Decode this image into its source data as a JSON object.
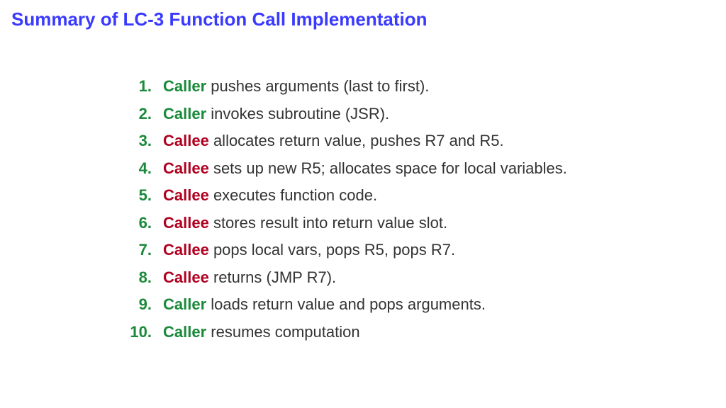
{
  "title": "Summary of LC-3 Function Call Implementation",
  "items": [
    {
      "n": "1.",
      "role": "Caller",
      "role_class": "role-caller",
      "text": " pushes arguments (last to first)."
    },
    {
      "n": "2.",
      "role": "Caller",
      "role_class": "role-caller",
      "text": " invokes subroutine (JSR)."
    },
    {
      "n": "3.",
      "role": "Callee",
      "role_class": "role-callee",
      "text": " allocates return value, pushes R7 and R5."
    },
    {
      "n": "4.",
      "role": "Callee",
      "role_class": "role-callee",
      "text": " sets up new R5; allocates space for local variables."
    },
    {
      "n": "5.",
      "role": "Callee",
      "role_class": "role-callee",
      "text": " executes function code."
    },
    {
      "n": "6.",
      "role": "Callee",
      "role_class": "role-callee",
      "text": " stores result into return value slot."
    },
    {
      "n": "7.",
      "role": "Callee",
      "role_class": "role-callee",
      "text": " pops local vars, pops R5, pops R7."
    },
    {
      "n": "8.",
      "role": "Callee",
      "role_class": "role-callee",
      "text": " returns (JMP R7)."
    },
    {
      "n": "9.",
      "role": "Caller",
      "role_class": "role-caller",
      "text": " loads return value and pops arguments."
    },
    {
      "n": "10.",
      "role": "Caller",
      "role_class": "role-caller",
      "text": " resumes computation"
    }
  ]
}
